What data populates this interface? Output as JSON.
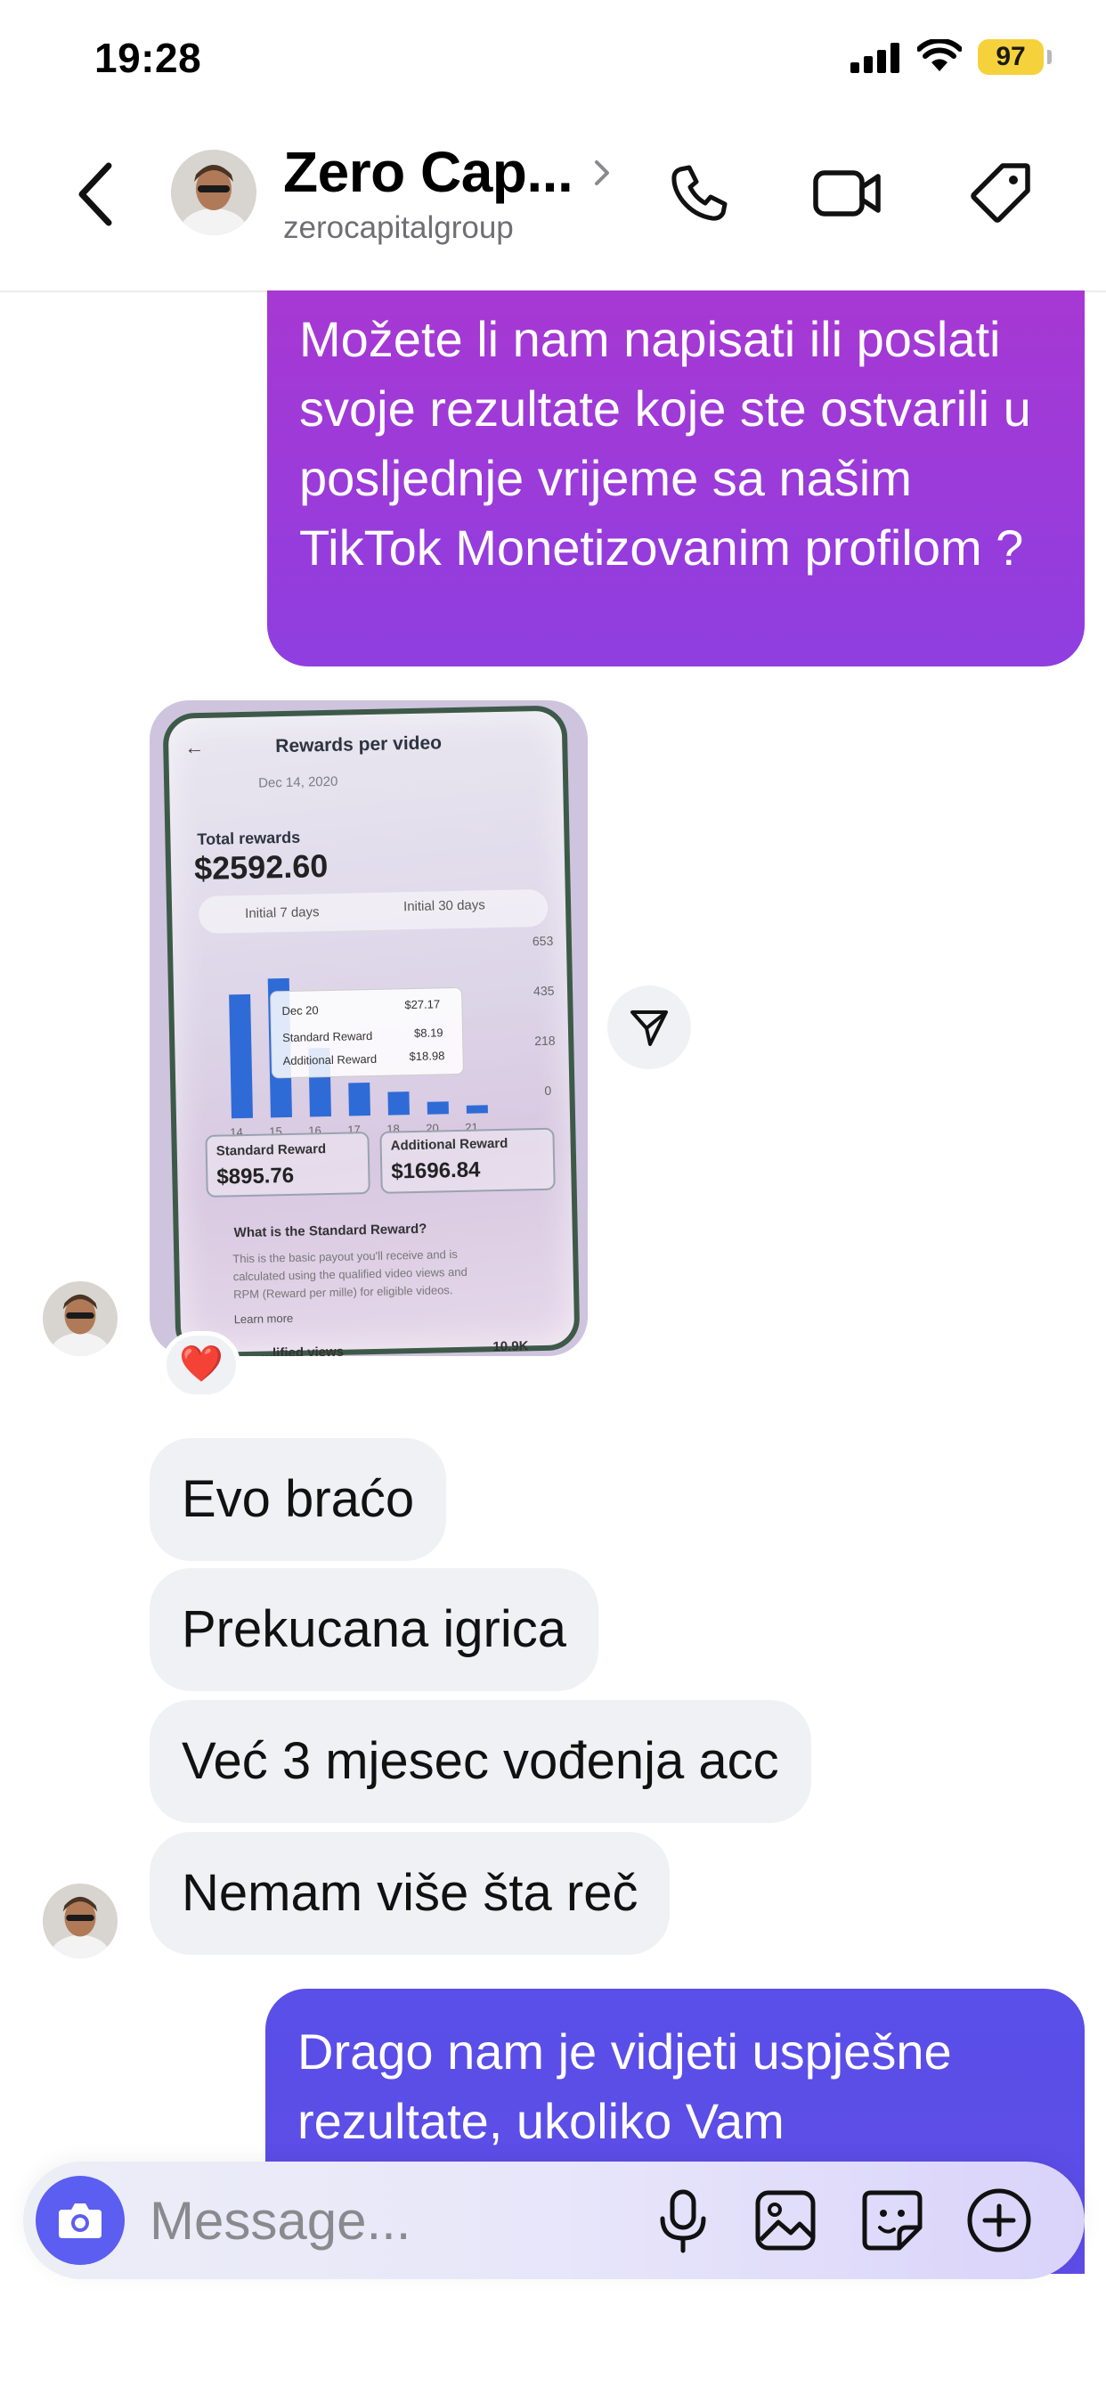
{
  "status_bar": {
    "time": "19:28",
    "battery": "97"
  },
  "header": {
    "name": "Zero Cap...",
    "handle": "zerocapitalgroup"
  },
  "messages": {
    "outgoing_1": "Možete li nam napisati ili poslati svoje rezultate koje ste ostvarili u posljednje vrijeme sa našim TikTok Monetizovanim profilom ?",
    "photo": {
      "header": "Rewards per video",
      "date": "Dec 14, 2020",
      "total_label": "Total rewards",
      "total_value": "$2592.60",
      "tab_a": "Initial 7 days",
      "tab_b": "Initial 30 days",
      "y_ticks": [
        "653",
        "435",
        "218",
        "0"
      ],
      "x_ticks": [
        "14",
        "15",
        "16",
        "17",
        "18",
        "20",
        "21"
      ],
      "bar_levels": [
        0.82,
        0.92,
        0.45,
        0.22,
        0.15,
        0.08,
        0.05
      ],
      "tooltip_date": "Dec 20",
      "tooltip_total": "$27.17",
      "tooltip_standard_label": "Standard Reward",
      "tooltip_standard_value": "$8.19",
      "tooltip_additional_label": "Additional Reward",
      "tooltip_additional_value": "$18.98",
      "standard_label": "Standard Reward",
      "standard_value": "$895.76",
      "additional_label": "Additional Reward",
      "additional_value": "$1696.84",
      "question": "What is the Standard Reward?",
      "body_1": "This is the basic payout you'll receive and is",
      "body_2": "calculated using the qualified video views and",
      "body_3": "RPM (Reward per mille) for eligible videos.",
      "learn_more": "Learn more",
      "footer_label": "...lified views",
      "footer_value": "10.9K"
    },
    "reaction": "❤️",
    "incoming_1": "Evo braćo",
    "incoming_2": "Prekucana igrica",
    "incoming_3": "Već 3 mjesec vođenja acc",
    "incoming_4": "Nemam više šta reč",
    "outgoing_2": "Drago nam je vidjeti uspješne rezultate, ukoliko Vam"
  },
  "composer": {
    "placeholder": "Message..."
  },
  "colors": {
    "outgoing_top": "#a738d3",
    "outgoing_bottom": "#5a4fe8",
    "incoming_bg": "#f0f1f4",
    "camera_button": "#5b5ef0",
    "battery": "#f5d13c"
  }
}
